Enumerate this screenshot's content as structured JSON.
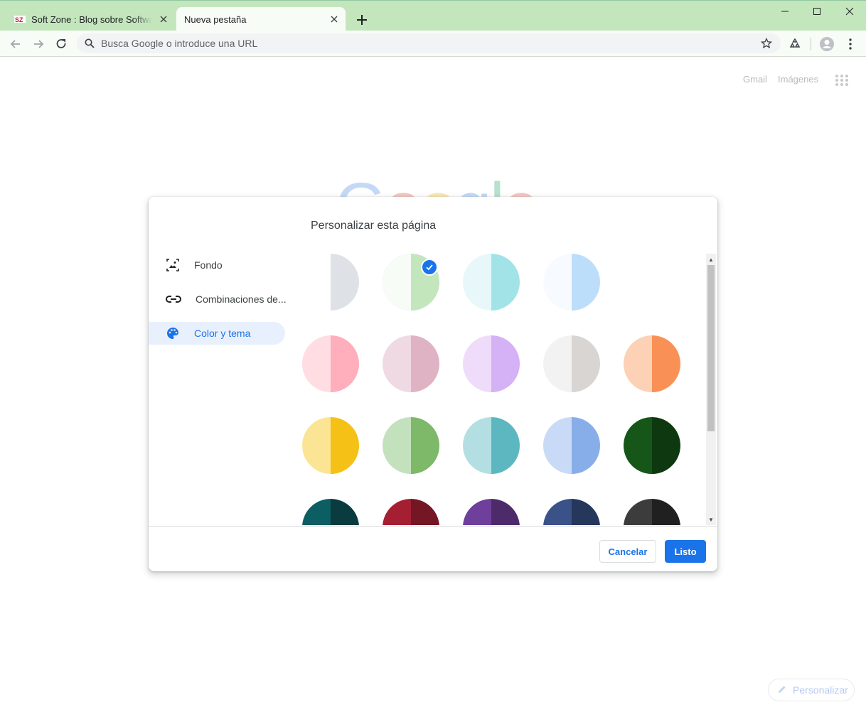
{
  "browser": {
    "tabs": [
      {
        "title": "Soft Zone : Blog sobre Software c",
        "active": false
      },
      {
        "title": "Nueva pestaña",
        "active": true
      }
    ],
    "omnibox": {
      "placeholder": "Busca Google o introduce una URL",
      "value": ""
    },
    "icons": [
      "back-icon",
      "forward-icon",
      "reload-icon",
      "search-icon",
      "star-icon",
      "extension-icon",
      "profile-icon",
      "menu-icon",
      "new-tab-icon",
      "minimize-icon",
      "maximize-icon",
      "close-icon"
    ]
  },
  "ntp": {
    "links": {
      "gmail": "Gmail",
      "images": "Imágenes"
    },
    "logo": "Google",
    "customize_label": "Personalizar"
  },
  "dialog": {
    "title": "Personalizar esta página",
    "menu": [
      {
        "label": "Fondo",
        "icon": "image-icon",
        "active": false
      },
      {
        "label": "Combinaciones de...",
        "icon": "link-icon",
        "active": false
      },
      {
        "label": "Color y tema",
        "icon": "palette-icon",
        "active": true
      }
    ],
    "swatches": [
      [
        {
          "left": "#ffffff",
          "right": "#dee1e6",
          "selected": false,
          "half": true
        },
        {
          "left": "#f8fcf7",
          "right": "#c4e6bd",
          "selected": true
        },
        {
          "left": "#e8f7fa",
          "right": "#a2e3e8"
        },
        {
          "left": "#f7fbff",
          "right": "#bddefb"
        }
      ],
      [
        {
          "left": "#ffdde3",
          "right": "#ffaebb"
        },
        {
          "left": "#efd9e2",
          "right": "#dfb3c4"
        },
        {
          "left": "#eedcfa",
          "right": "#d5b1f6"
        },
        {
          "left": "#f3f2f2",
          "right": "#d9d5d3"
        },
        {
          "left": "#fdd1b6",
          "right": "#f99157"
        }
      ],
      [
        {
          "left": "#fbe595",
          "right": "#f5c116"
        },
        {
          "left": "#c4e1be",
          "right": "#7db968"
        },
        {
          "left": "#b4dfe2",
          "right": "#5cb7c0"
        },
        {
          "left": "#c8daf5",
          "right": "#88aeea"
        },
        {
          "left": "#175619",
          "right": "#0e3910"
        }
      ],
      [
        {
          "left": "#0d5e62",
          "right": "#0a3b3e"
        },
        {
          "left": "#a51f33",
          "right": "#741624"
        },
        {
          "left": "#6f3f9c",
          "right": "#4d2b6b"
        },
        {
          "left": "#3a5288",
          "right": "#26375c"
        },
        {
          "left": "#3c3c3c",
          "right": "#202020"
        }
      ]
    ],
    "buttons": {
      "cancel": "Cancelar",
      "done": "Listo"
    }
  },
  "colors": {
    "accent": "#1a73e8",
    "frame": "#c4e6bd",
    "toolbar": "#f8fcf7"
  }
}
